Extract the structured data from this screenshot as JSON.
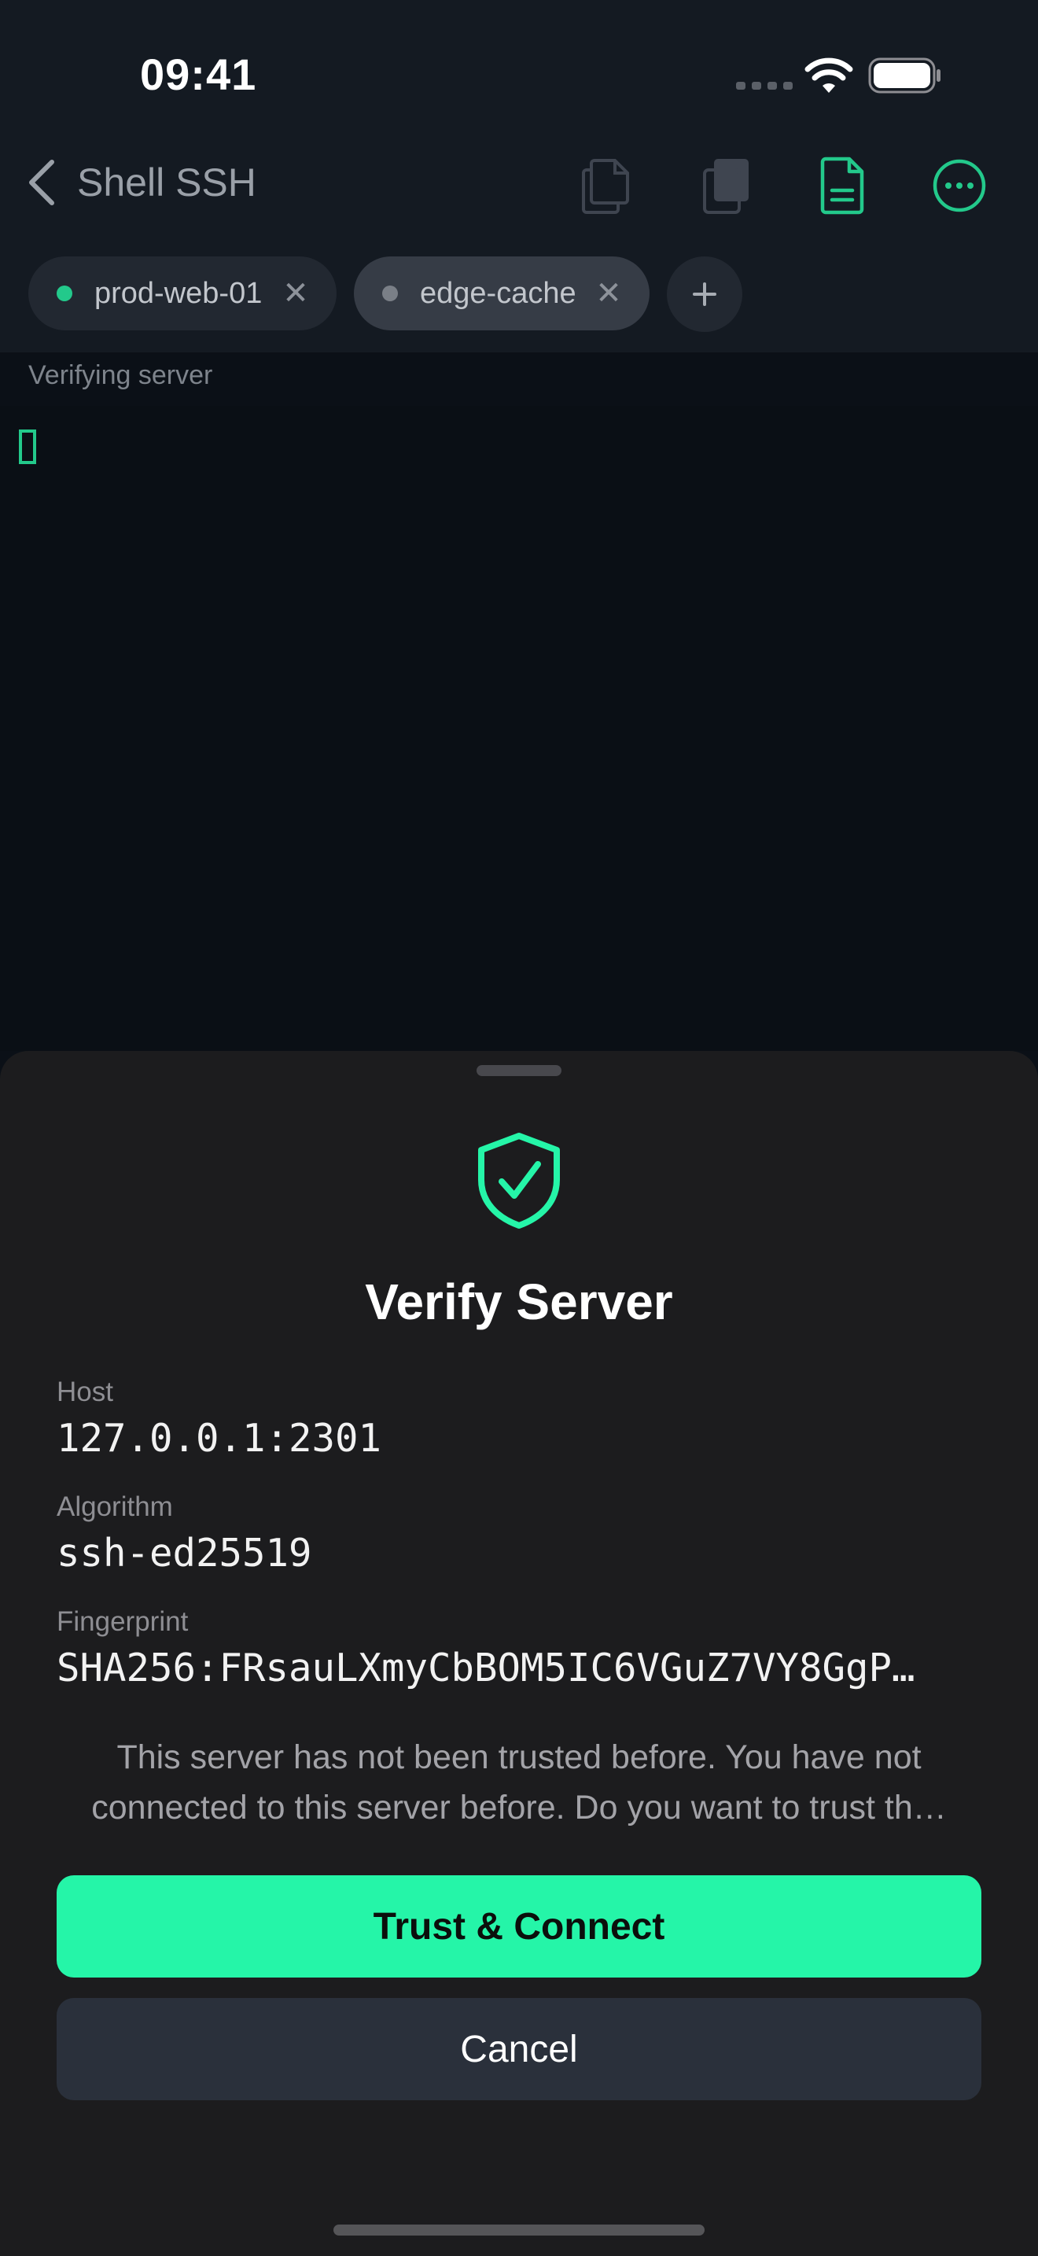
{
  "status_bar": {
    "time": "09:41"
  },
  "nav": {
    "title": "Shell SSH",
    "icons": [
      "copy-document-icon",
      "paste-clipboard-icon",
      "document-icon",
      "more-options-icon"
    ]
  },
  "tabs": [
    {
      "label": "prod-web-01",
      "status_color": "#23c98b",
      "close": "✕"
    },
    {
      "label": "edge-cache",
      "status_color": "#7a7f87",
      "close": "✕"
    }
  ],
  "add_tab_label": "+",
  "section_label": "Verifying server",
  "sheet": {
    "title": "Verify Server",
    "fields": [
      {
        "label": "Host",
        "value": "127.0.0.1:2301"
      },
      {
        "label": "Algorithm",
        "value": "ssh-ed25519"
      },
      {
        "label": "Fingerprint",
        "value": "SHA256:FRsauLXmyCbBOM5IC6VGuZ7VY8GgP…"
      }
    ],
    "message_lines": [
      "This server has not been trusted before. You have not",
      "connected to this server before. Do you want to trust th…"
    ],
    "primary_button": "Trust & Connect",
    "secondary_button": "Cancel"
  },
  "colors": {
    "accent": "#25f5a8",
    "accent_dark": "#23c98b",
    "background": "#0b1017",
    "sheet": "#1c1c1e"
  }
}
